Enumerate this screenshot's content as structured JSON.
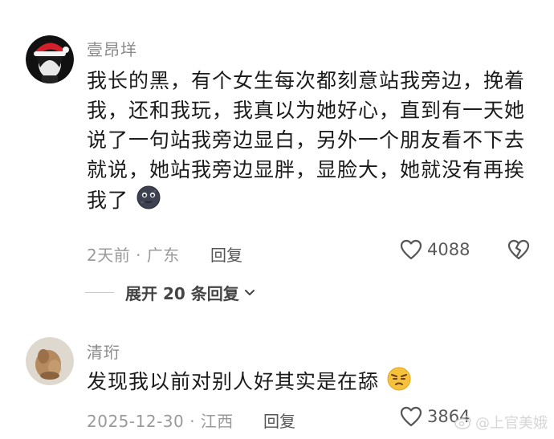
{
  "comments": [
    {
      "username": "壹昂垟",
      "text_lines": [
        "我长的黑，有个女生每次都刻意站我旁边，挽着",
        "我，还和我玩，我真以为她好心，直到有一天她",
        "说了一句站我旁边显白，另外一个朋友看不下去",
        "就说，她站我旁边显胖，显脸大，她就没有再挨",
        "我了"
      ],
      "emoji": "dark-moon-face",
      "meta": "2天前 · 广东",
      "reply_label": "回复",
      "likes": "4088"
    },
    {
      "username": "清珩",
      "text": "发现我以前对别人好其实是在舔",
      "emoji": "unamused-face",
      "meta": "2025-12-30 · 江西",
      "reply_label": "回复",
      "likes": "3864"
    }
  ],
  "expand_replies": "展开 20 条回复",
  "watermark": "@上官美娥",
  "icons": {
    "like": "heart-outline-icon",
    "dislike": "broken-heart-icon",
    "expand": "chevron-down-icon"
  }
}
